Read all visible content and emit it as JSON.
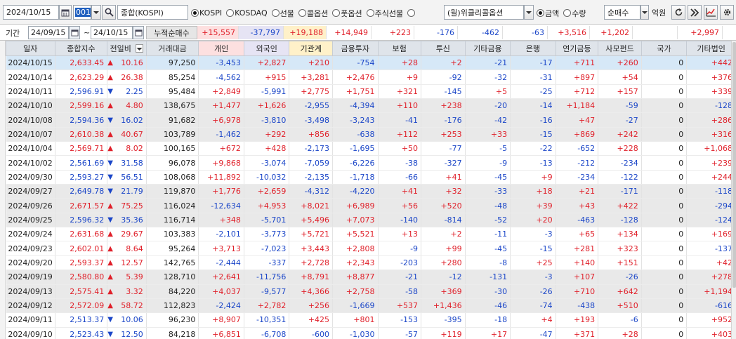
{
  "toolbar": {
    "date": "2024/10/15",
    "code": "001",
    "stock_name": "종합(KOSPI)",
    "markets": [
      {
        "label": "KOSPI",
        "checked": true
      },
      {
        "label": "KOSDAQ",
        "checked": false
      },
      {
        "label": "선물",
        "checked": false
      },
      {
        "label": "콜옵션",
        "checked": false
      },
      {
        "label": "풋옵션",
        "checked": false
      },
      {
        "label": "주식선물",
        "checked": false
      },
      {
        "label": "",
        "checked": false
      }
    ],
    "weekly_option": "(월)위클리콜옵션",
    "units": [
      {
        "label": "금액",
        "checked": true
      },
      {
        "label": "수량",
        "checked": false
      }
    ],
    "mode": "순매수",
    "unit_label": "억원"
  },
  "filter": {
    "period_label": "기간",
    "start_date": "24/09/15",
    "separator": "~",
    "end_date": "24/10/15",
    "cumulative_label": "누적순매수",
    "sums": [
      "+15,557",
      "-37,797",
      "+19,188",
      "+14,949",
      "+223",
      "-176",
      "-462",
      "-63",
      "+3,516",
      "+1,202",
      "",
      "+2,997"
    ]
  },
  "table": {
    "headers": [
      "일자",
      "종합지수",
      "전일비",
      "거래대금",
      "개인",
      "외국인",
      "기관계",
      "금융투자",
      "보험",
      "투신",
      "기타금융",
      "은행",
      "연기금등",
      "사모펀드",
      "국가",
      "기타법인"
    ],
    "rows": [
      {
        "date": "2024/10/15",
        "index": "2,633.45",
        "dir": "up",
        "chg": "10.16",
        "amount": "97,250",
        "vals": [
          "-3,453",
          "+2,827",
          "+210",
          "-754",
          "+28",
          "+2",
          "-21",
          "-17",
          "+711",
          "+260",
          "0",
          "+442"
        ]
      },
      {
        "date": "2024/10/14",
        "index": "2,623.29",
        "dir": "up",
        "chg": "26.38",
        "amount": "85,254",
        "vals": [
          "-4,562",
          "+915",
          "+3,281",
          "+2,476",
          "+9",
          "-92",
          "-32",
          "-31",
          "+897",
          "+54",
          "0",
          "+376"
        ]
      },
      {
        "date": "2024/10/11",
        "index": "2,596.91",
        "dir": "down",
        "chg": "2.25",
        "amount": "95,484",
        "vals": [
          "+2,849",
          "-5,991",
          "+2,775",
          "+1,751",
          "+321",
          "-145",
          "+5",
          "-25",
          "+712",
          "+157",
          "0",
          "+339"
        ]
      },
      {
        "date": "2024/10/10",
        "index": "2,599.16",
        "dir": "up",
        "chg": "4.80",
        "amount": "138,675",
        "vals": [
          "+1,477",
          "+1,626",
          "-2,955",
          "-4,394",
          "+110",
          "+238",
          "-20",
          "-14",
          "+1,184",
          "-59",
          "0",
          "-128"
        ]
      },
      {
        "date": "2024/10/08",
        "index": "2,594.36",
        "dir": "down",
        "chg": "16.02",
        "amount": "91,682",
        "vals": [
          "+6,978",
          "-3,810",
          "-3,498",
          "-3,243",
          "-41",
          "-176",
          "-42",
          "-16",
          "+47",
          "-27",
          "0",
          "+286"
        ]
      },
      {
        "date": "2024/10/07",
        "index": "2,610.38",
        "dir": "up",
        "chg": "40.67",
        "amount": "103,789",
        "vals": [
          "-1,462",
          "+292",
          "+856",
          "-638",
          "+112",
          "+253",
          "+33",
          "-15",
          "+869",
          "+242",
          "0",
          "+316"
        ]
      },
      {
        "date": "2024/10/04",
        "index": "2,569.71",
        "dir": "up",
        "chg": "8.02",
        "amount": "100,165",
        "vals": [
          "+672",
          "+428",
          "-2,173",
          "-1,695",
          "+50",
          "-77",
          "-5",
          "-22",
          "-652",
          "+228",
          "0",
          "+1,068"
        ]
      },
      {
        "date": "2024/10/02",
        "index": "2,561.69",
        "dir": "down",
        "chg": "31.58",
        "amount": "96,078",
        "vals": [
          "+9,868",
          "-3,074",
          "-7,059",
          "-6,226",
          "-38",
          "-327",
          "-9",
          "-13",
          "-212",
          "-234",
          "0",
          "+239"
        ]
      },
      {
        "date": "2024/09/30",
        "index": "2,593.27",
        "dir": "down",
        "chg": "56.51",
        "amount": "108,068",
        "vals": [
          "+11,892",
          "-10,032",
          "-2,135",
          "-1,718",
          "-66",
          "+41",
          "-45",
          "+9",
          "-234",
          "-122",
          "0",
          "+244"
        ]
      },
      {
        "date": "2024/09/27",
        "index": "2,649.78",
        "dir": "down",
        "chg": "21.79",
        "amount": "119,870",
        "vals": [
          "+1,776",
          "+2,659",
          "-4,312",
          "-4,220",
          "+41",
          "+32",
          "-33",
          "+18",
          "+21",
          "-171",
          "0",
          "-118"
        ]
      },
      {
        "date": "2024/09/26",
        "index": "2,671.57",
        "dir": "up",
        "chg": "75.25",
        "amount": "116,024",
        "vals": [
          "-12,634",
          "+4,953",
          "+8,021",
          "+6,989",
          "+56",
          "+520",
          "-48",
          "+39",
          "+43",
          "+422",
          "0",
          "-294"
        ]
      },
      {
        "date": "2024/09/25",
        "index": "2,596.32",
        "dir": "down",
        "chg": "35.36",
        "amount": "116,714",
        "vals": [
          "+348",
          "-5,701",
          "+5,496",
          "+7,073",
          "-140",
          "-814",
          "-52",
          "+20",
          "-463",
          "-128",
          "0",
          "-124"
        ]
      },
      {
        "date": "2024/09/24",
        "index": "2,631.68",
        "dir": "up",
        "chg": "29.67",
        "amount": "103,383",
        "vals": [
          "-2,101",
          "-3,773",
          "+5,721",
          "+5,521",
          "+13",
          "+2",
          "-11",
          "-3",
          "+65",
          "+134",
          "0",
          "+169"
        ]
      },
      {
        "date": "2024/09/23",
        "index": "2,602.01",
        "dir": "up",
        "chg": "8.64",
        "amount": "95,264",
        "vals": [
          "+3,713",
          "-7,023",
          "+3,443",
          "+2,808",
          "-9",
          "+99",
          "-45",
          "-15",
          "+281",
          "+323",
          "0",
          "-137"
        ]
      },
      {
        "date": "2024/09/20",
        "index": "2,593.37",
        "dir": "up",
        "chg": "12.57",
        "amount": "142,765",
        "vals": [
          "-2,444",
          "-337",
          "+2,728",
          "+2,343",
          "-203",
          "+280",
          "-8",
          "+25",
          "+140",
          "+151",
          "0",
          "+42"
        ]
      },
      {
        "date": "2024/09/19",
        "index": "2,580.80",
        "dir": "up",
        "chg": "5.39",
        "amount": "128,710",
        "vals": [
          "+2,641",
          "-11,756",
          "+8,791",
          "+8,877",
          "-21",
          "-12",
          "-131",
          "-3",
          "+107",
          "-26",
          "0",
          "+278"
        ]
      },
      {
        "date": "2024/09/13",
        "index": "2,575.41",
        "dir": "up",
        "chg": "3.32",
        "amount": "84,220",
        "vals": [
          "+4,037",
          "-9,577",
          "+4,366",
          "+2,758",
          "-58",
          "+369",
          "-30",
          "-26",
          "+710",
          "+642",
          "0",
          "+1,194"
        ]
      },
      {
        "date": "2024/09/12",
        "index": "2,572.09",
        "dir": "up",
        "chg": "58.72",
        "amount": "112,823",
        "vals": [
          "-2,424",
          "+2,782",
          "+256",
          "-1,669",
          "+537",
          "+1,436",
          "-46",
          "-74",
          "-438",
          "+510",
          "0",
          "-616"
        ]
      },
      {
        "date": "2024/09/11",
        "index": "2,513.37",
        "dir": "down",
        "chg": "10.06",
        "amount": "96,230",
        "vals": [
          "+8,907",
          "-10,351",
          "+425",
          "+801",
          "-153",
          "-395",
          "-18",
          "+4",
          "+193",
          "-6",
          "0",
          "+952"
        ]
      },
      {
        "date": "2024/09/10",
        "index": "2,523.43",
        "dir": "down",
        "chg": "12.50",
        "amount": "84,218",
        "vals": [
          "+6,851",
          "-6,708",
          "-600",
          "-1,030",
          "-57",
          "+119",
          "+17",
          "-47",
          "+371",
          "+28",
          "0",
          "+403"
        ]
      }
    ]
  },
  "colors": {
    "up": "#e0202a",
    "down": "#1b46c8",
    "selected_row": "#d6e8f7",
    "shaded_row": "#e9e9e9",
    "header_bg": "#dfe4ea",
    "sum_bg": [
      "#fde0e0",
      "#e6e4f4",
      "#fff1c9",
      "#ffffff"
    ]
  }
}
